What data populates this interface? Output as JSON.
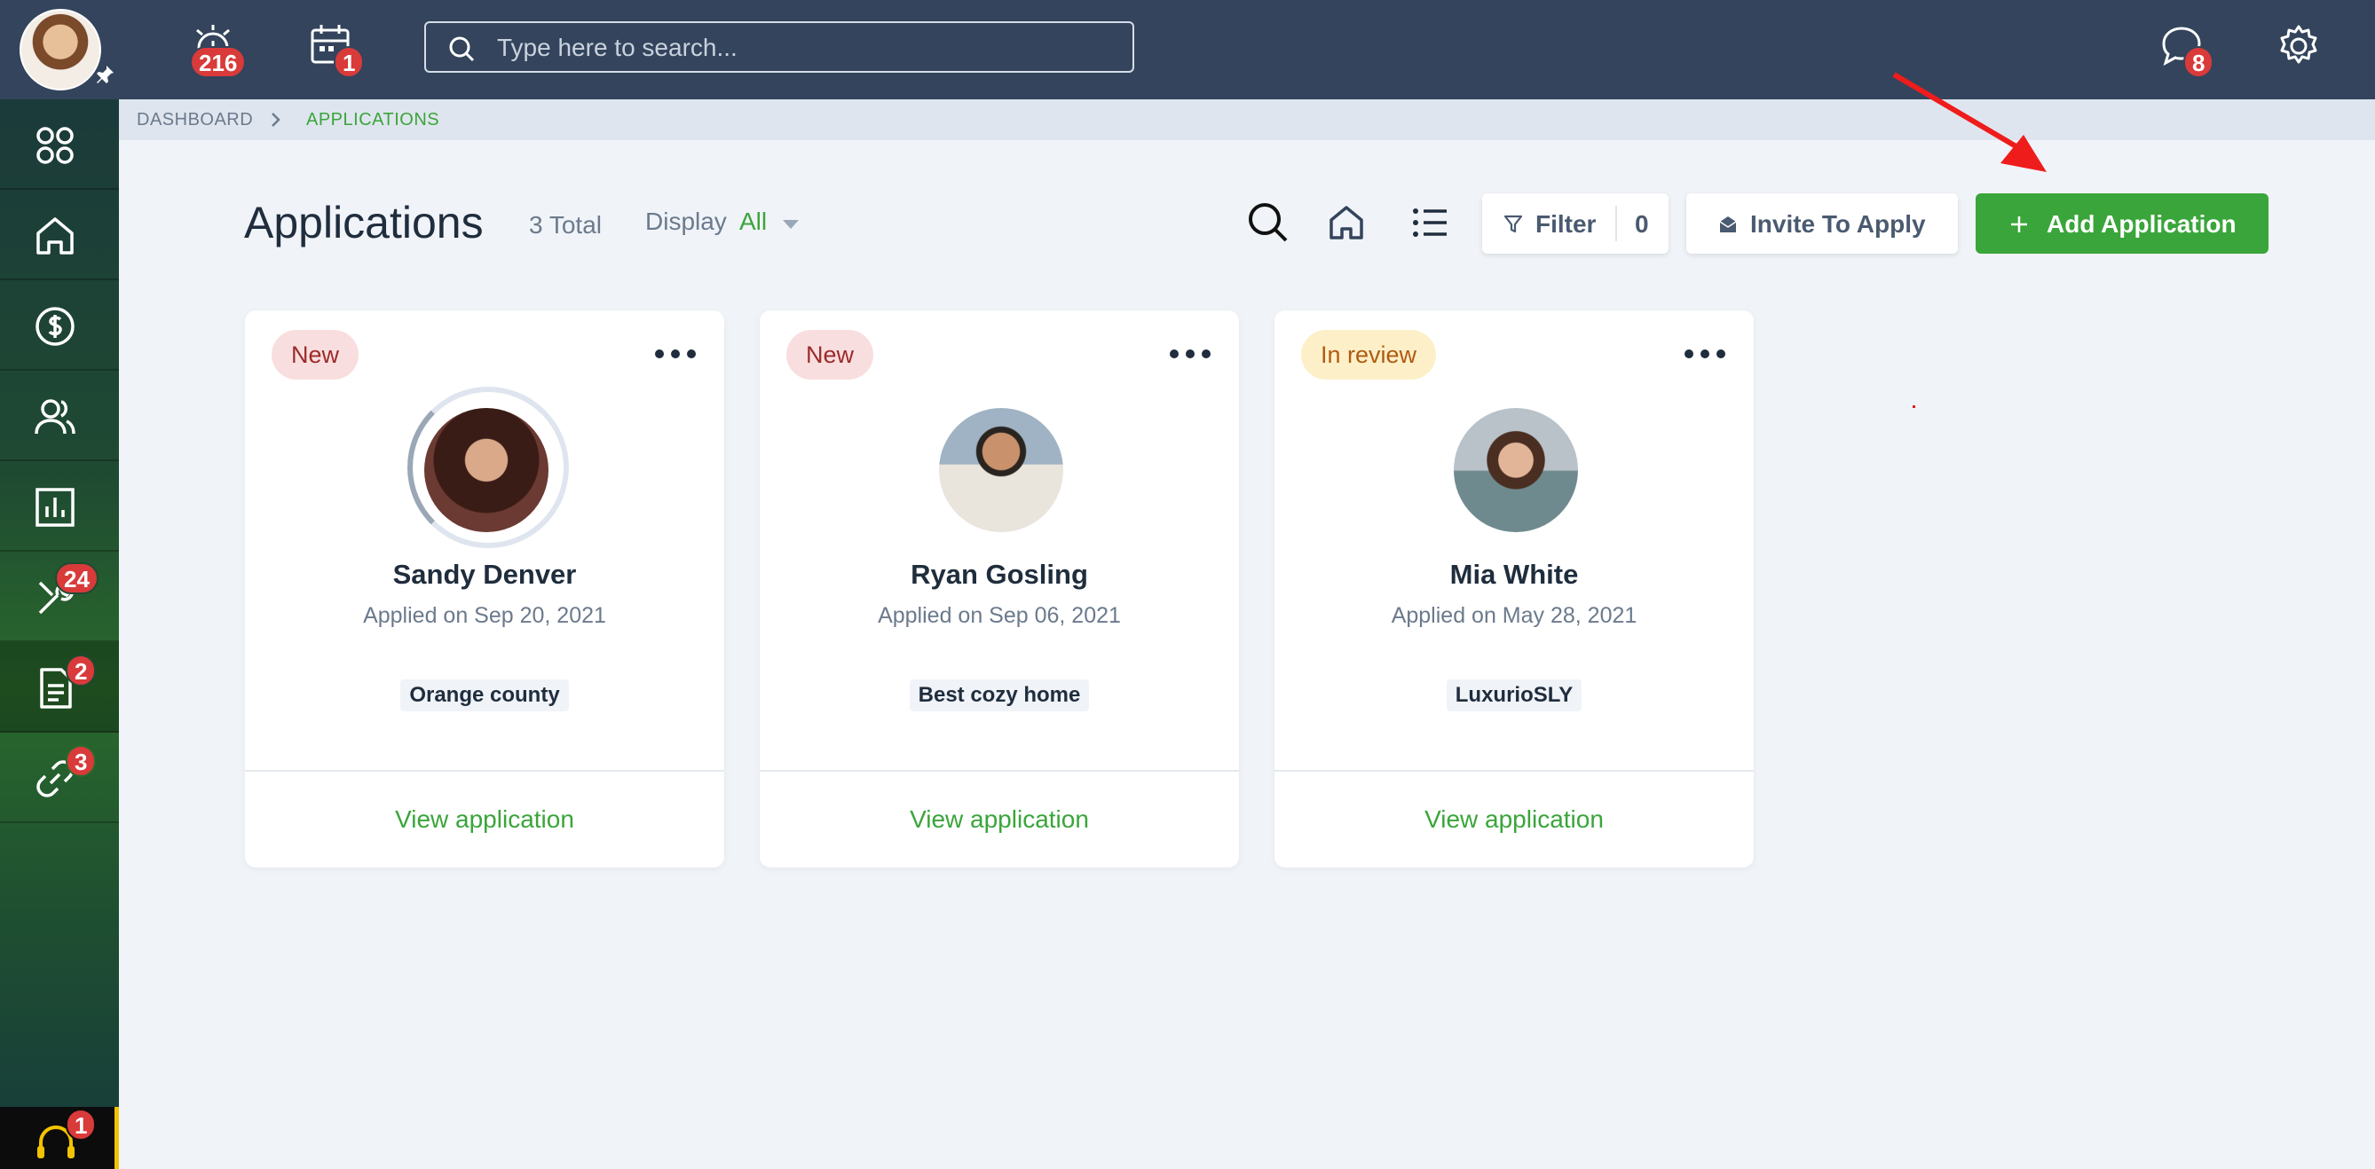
{
  "topbar": {
    "notifications_badge": "216",
    "calendar_badge": "1",
    "search_placeholder": "Type here to search...",
    "messages_badge": "8"
  },
  "sidebar": {
    "tools_badge": "24",
    "applications_badge": "2",
    "links_badge": "3",
    "support_badge": "1"
  },
  "breadcrumb": {
    "items": [
      "DASHBOARD",
      "APPLICATIONS"
    ]
  },
  "header": {
    "title": "Applications",
    "total": "3 Total",
    "display_label": "Display",
    "display_value": "All",
    "filter_label": "Filter",
    "filter_count": "0",
    "invite_label": "Invite To Apply",
    "add_label": "Add Application"
  },
  "cards": [
    {
      "status": "New",
      "name": "Sandy Denver",
      "applied": "Applied on Sep 20, 2021",
      "property": "Orange county",
      "action": "View application"
    },
    {
      "status": "New",
      "name": "Ryan Gosling",
      "applied": "Applied on Sep 06, 2021",
      "property": "Best cozy home",
      "action": "View application"
    },
    {
      "status": "In review",
      "name": "Mia White",
      "applied": "Applied on May 28, 2021",
      "property": "LuxurioSLY",
      "action": "View application"
    }
  ],
  "colors": {
    "topbar": "#33445c",
    "accent_green": "#3aa53a",
    "badge_red": "#d93a3a",
    "status_new_bg": "#f9dedf",
    "status_review_bg": "#fdf0c8"
  }
}
